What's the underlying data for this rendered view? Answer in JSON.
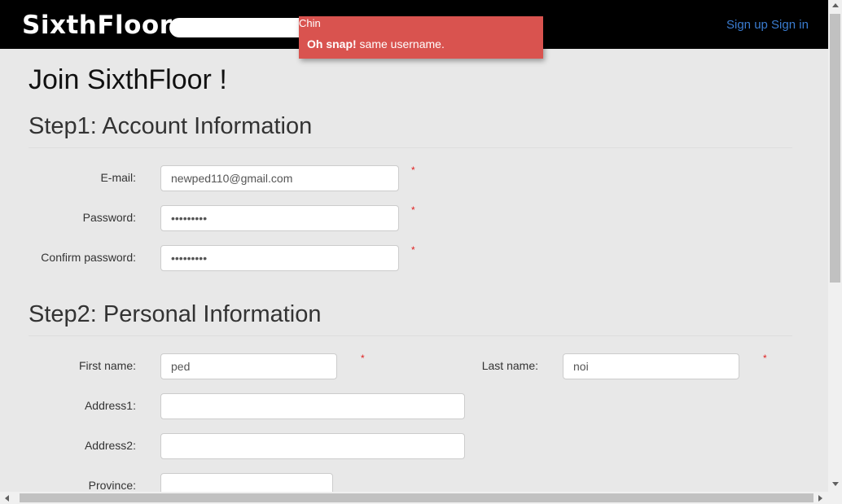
{
  "navbar": {
    "brand": "SixthFloor",
    "signup_label": "Sign up",
    "signin_label": "Sign in"
  },
  "alert": {
    "title": "Chin",
    "strong": "Oh snap!",
    "message": " same username."
  },
  "page": {
    "title": "Join SixthFloor !"
  },
  "step1": {
    "heading": "Step1: Account Information",
    "email_label": "E-mail:",
    "email_value": "newped110@gmail.com",
    "password_label": "Password:",
    "password_value": "•••••••••",
    "confirm_label": "Confirm password:",
    "confirm_value": "•••••••••",
    "required_mark": "*"
  },
  "step2": {
    "heading": "Step2: Personal Information",
    "first_name_label": "First name:",
    "first_name_value": "ped",
    "last_name_label": "Last name:",
    "last_name_value": "noi",
    "address1_label": "Address1:",
    "address1_value": "",
    "address2_label": "Address2:",
    "address2_value": "",
    "province_label": "Province:",
    "province_value": "",
    "required_mark": "*"
  },
  "colors": {
    "navbar_bg": "#000000",
    "alert_bg": "#d9534f",
    "link": "#3a7cd0",
    "required": "#e02020",
    "page_bg": "#e8e8e8"
  }
}
